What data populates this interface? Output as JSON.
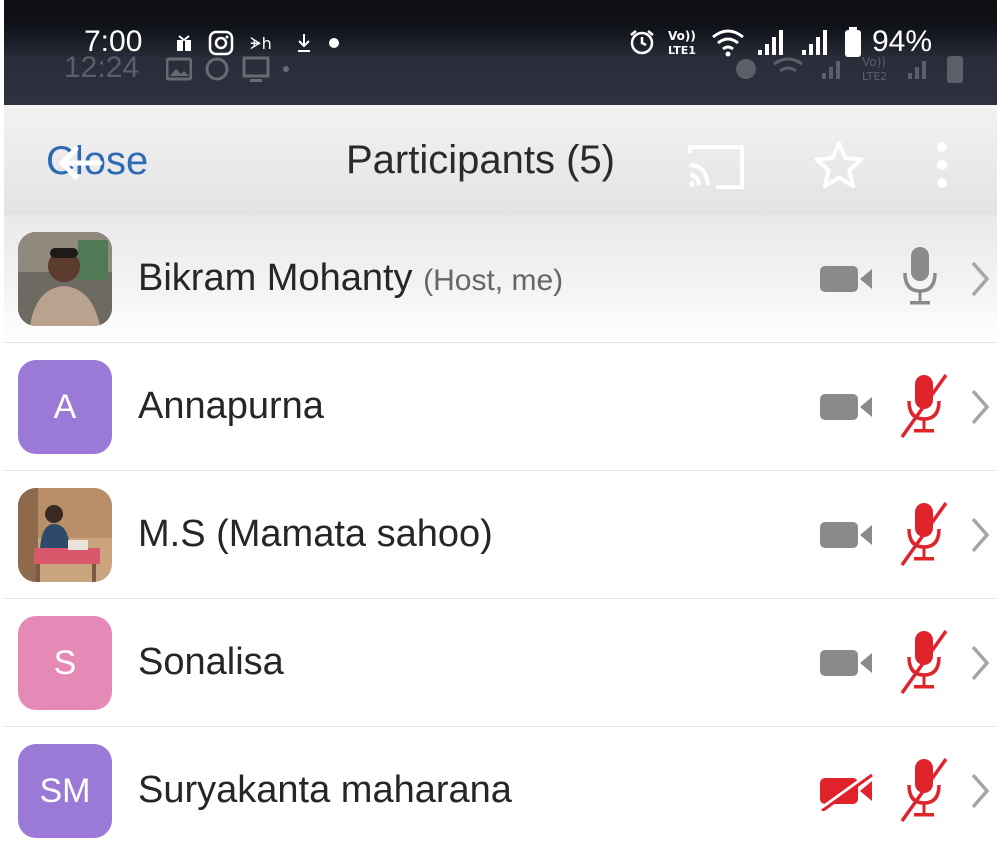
{
  "status_bar": {
    "time": "7:00",
    "time_ghost": "12:24",
    "battery": "94%",
    "icons": [
      "gift-icon",
      "instagram-icon",
      "app-dh-icon",
      "download-icon",
      "dot-icon",
      "alarm-icon",
      "volte-lte1-icon",
      "wifi-icon",
      "signal-icon",
      "signal-icon",
      "battery-icon"
    ]
  },
  "header": {
    "close_label": "Close",
    "title": "Participants (5)",
    "icons": [
      "back-arrow-icon",
      "cast-icon",
      "star-icon",
      "more-vert-icon"
    ]
  },
  "participants": [
    {
      "name": "Bikram Mohanty",
      "role": "(Host, me)",
      "avatar": "photo",
      "video_on": true,
      "mic_on": true
    },
    {
      "name": "Annapurna",
      "role": "",
      "avatar_initials": "A",
      "avatar_color": "#9a7ad6",
      "video_on": true,
      "mic_on": false
    },
    {
      "name": "M.S (Mamata sahoo)",
      "role": "",
      "avatar": "photo",
      "video_on": true,
      "mic_on": false
    },
    {
      "name": "Sonalisa",
      "role": "",
      "avatar_initials": "S",
      "avatar_color": "#e58ab7",
      "video_on": true,
      "mic_on": false
    },
    {
      "name": "Suryakanta maharana",
      "role": "",
      "avatar_initials": "SM",
      "avatar_color": "#9a7ad6",
      "video_on": false,
      "mic_on": false
    }
  ],
  "colors": {
    "muted_red": "#e0232b",
    "icon_gray": "#8a8a8a",
    "link_blue": "#2c6bb3"
  }
}
